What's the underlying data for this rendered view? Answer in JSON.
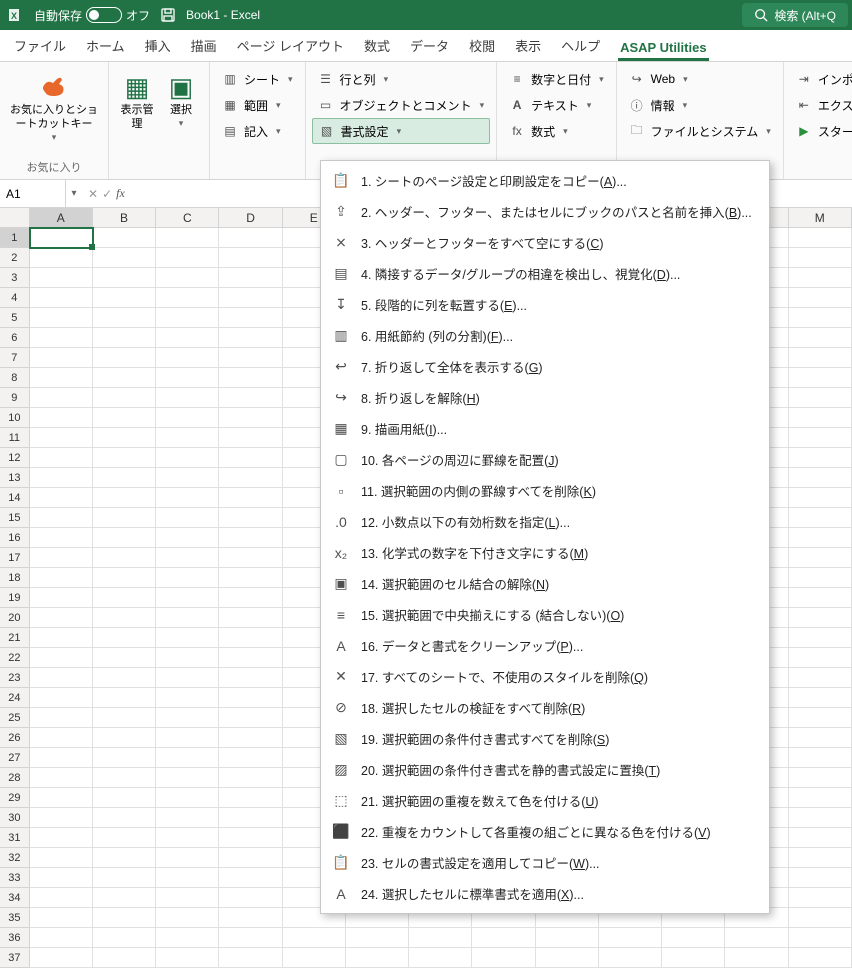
{
  "titlebar": {
    "autosave_label": "自動保存",
    "autosave_state": "オフ",
    "title": "Book1  -  Excel",
    "search_label": "検索 (Alt+Q"
  },
  "tabs": {
    "items": [
      "ファイル",
      "ホーム",
      "挿入",
      "描画",
      "ページ レイアウト",
      "数式",
      "データ",
      "校閲",
      "表示",
      "ヘルプ",
      "ASAP Utilities"
    ],
    "active_index": 10
  },
  "ribbon": {
    "fav_big": "お気に入りとショートカットキー",
    "fav_group": "お気に入り",
    "view_mgr": "表示管理",
    "select": "選択",
    "col_a": {
      "sheet": "シート",
      "range": "範囲",
      "entry": "記入"
    },
    "col_b": {
      "rowscols": "行と列",
      "objects": "オブジェクトとコメント",
      "format": "書式設定"
    },
    "col_c": {
      "numdate": "数字と日付",
      "text": "テキスト",
      "formula": "数式"
    },
    "col_d": {
      "web": "Web",
      "info": "情報",
      "filesys": "ファイルとシステム"
    },
    "col_e": {
      "import": "インポート",
      "export": "エクスポート",
      "start": "スタート"
    }
  },
  "cellref": "A1",
  "columns": [
    "A",
    "B",
    "C",
    "D",
    "E",
    "",
    "",
    "",
    "",
    "",
    "",
    "",
    "M"
  ],
  "rowcount": 37,
  "menu": {
    "items": [
      {
        "n": "1",
        "t": "シートのページ設定と印刷設定をコピー(",
        "u": "A",
        "s": ")..."
      },
      {
        "n": "2",
        "t": "ヘッダー、フッター、またはセルにブックのパスと名前を挿入(",
        "u": "B",
        "s": ")..."
      },
      {
        "n": "3",
        "t": "ヘッダーとフッターをすべて空にする(",
        "u": "C",
        "s": ")"
      },
      {
        "n": "4",
        "t": "隣接するデータ/グループの相違を検出し、視覚化(",
        "u": "D",
        "s": ")..."
      },
      {
        "n": "5",
        "t": "段階的に列を転置する(",
        "u": "E",
        "s": ")..."
      },
      {
        "n": "6",
        "t": "用紙節約 (列の分割)(",
        "u": "F",
        "s": ")..."
      },
      {
        "n": "7",
        "t": "折り返して全体を表示する(",
        "u": "G",
        "s": ")"
      },
      {
        "n": "8",
        "t": "折り返しを解除(",
        "u": "H",
        "s": ")"
      },
      {
        "n": "9",
        "t": "描画用紙(",
        "u": "I",
        "s": ")..."
      },
      {
        "n": "10",
        "t": "各ページの周辺に罫線を配置(",
        "u": "J",
        "s": ")"
      },
      {
        "n": "11",
        "t": "選択範囲の内側の罫線すべてを削除(",
        "u": "K",
        "s": ")"
      },
      {
        "n": "12",
        "t": "小数点以下の有効桁数を指定(",
        "u": "L",
        "s": ")..."
      },
      {
        "n": "13",
        "t": "化学式の数字を下付き文字にする(",
        "u": "M",
        "s": ")"
      },
      {
        "n": "14",
        "t": "選択範囲のセル結合の解除(",
        "u": "N",
        "s": ")"
      },
      {
        "n": "15",
        "t": "選択範囲で中央揃えにする (結合しない)(",
        "u": "O",
        "s": ")"
      },
      {
        "n": "16",
        "t": "データと書式をクリーンアップ(",
        "u": "P",
        "s": ")..."
      },
      {
        "n": "17",
        "t": "すべてのシートで、不使用のスタイルを削除(",
        "u": "Q",
        "s": ")"
      },
      {
        "n": "18",
        "t": "選択したセルの検証をすべて削除(",
        "u": "R",
        "s": ")"
      },
      {
        "n": "19",
        "t": "選択範囲の条件付き書式すべてを削除(",
        "u": "S",
        "s": ")"
      },
      {
        "n": "20",
        "t": "選択範囲の条件付き書式を静的書式設定に置換(",
        "u": "T",
        "s": ")"
      },
      {
        "n": "21",
        "t": "選択範囲の重複を数えて色を付ける(",
        "u": "U",
        "s": ")"
      },
      {
        "n": "22",
        "t": "重複をカウントして各重複の組ごとに異なる色を付ける(",
        "u": "V",
        "s": ")"
      },
      {
        "n": "23",
        "t": "セルの書式設定を適用してコピー(",
        "u": "W",
        "s": ")..."
      },
      {
        "n": "24",
        "t": "選択したセルに標準書式を適用(",
        "u": "X",
        "s": ")..."
      }
    ]
  }
}
